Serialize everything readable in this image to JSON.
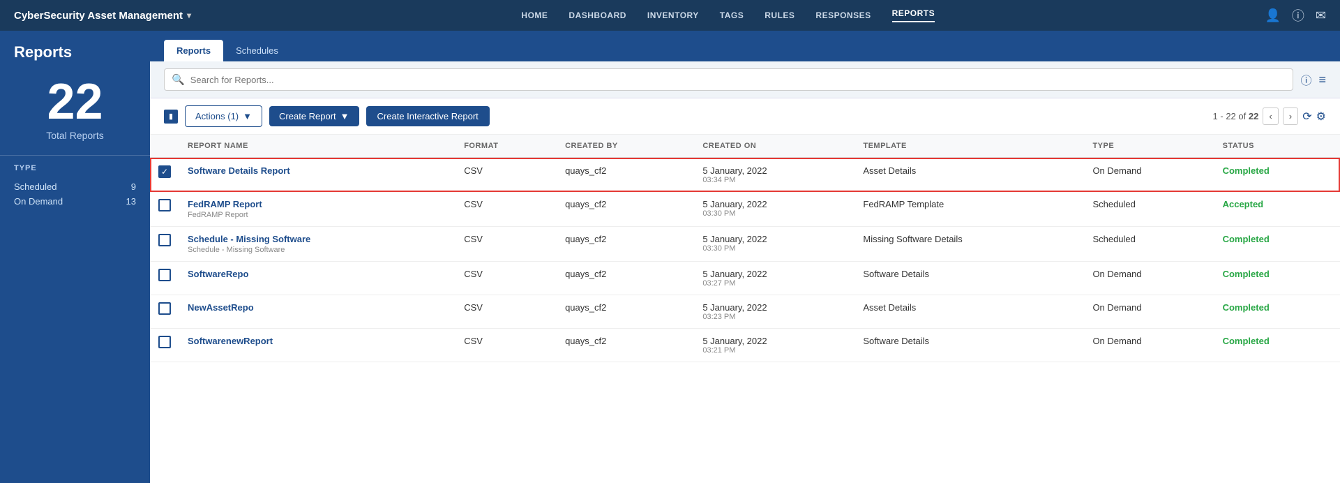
{
  "app": {
    "title": "CyberSecurity Asset Management",
    "dropdown_arrow": "▾"
  },
  "nav": {
    "items": [
      {
        "label": "HOME",
        "active": false
      },
      {
        "label": "DASHBOARD",
        "active": false
      },
      {
        "label": "INVENTORY",
        "active": false
      },
      {
        "label": "TAGS",
        "active": false
      },
      {
        "label": "RULES",
        "active": false
      },
      {
        "label": "RESPONSES",
        "active": false
      },
      {
        "label": "REPORTS",
        "active": true
      }
    ]
  },
  "sidebar": {
    "title": "Reports",
    "total_count": "22",
    "total_label": "Total Reports",
    "filter_title": "TYPE",
    "filters": [
      {
        "name": "Scheduled",
        "count": "9"
      },
      {
        "name": "On Demand",
        "count": "13"
      }
    ]
  },
  "tabs": [
    {
      "label": "Reports",
      "active": true
    },
    {
      "label": "Schedules",
      "active": false
    }
  ],
  "toolbar": {
    "search_placeholder": "Search for Reports...",
    "help_icon": "?",
    "menu_icon": "≡"
  },
  "actions_bar": {
    "actions_label": "Actions (1)",
    "create_report_label": "Create Report",
    "create_interactive_label": "Create Interactive Report",
    "pagination_text": "1 - 22 of",
    "pagination_total": "22"
  },
  "table": {
    "headers": [
      "",
      "REPORT NAME",
      "FORMAT",
      "CREATED BY",
      "CREATED ON",
      "TEMPLATE",
      "TYPE",
      "STATUS"
    ],
    "rows": [
      {
        "selected": true,
        "name": "Software Details Report",
        "sub": "",
        "format": "CSV",
        "created_by": "quays_cf2",
        "created_on": "5 January, 2022",
        "created_time": "03:34 PM",
        "template": "Asset Details",
        "type": "On Demand",
        "status": "Completed",
        "status_class": "status-completed"
      },
      {
        "selected": false,
        "name": "FedRAMP Report",
        "sub": "FedRAMP Report",
        "format": "CSV",
        "created_by": "quays_cf2",
        "created_on": "5 January, 2022",
        "created_time": "03:30 PM",
        "template": "FedRAMP Template",
        "type": "Scheduled",
        "status": "Accepted",
        "status_class": "status-accepted"
      },
      {
        "selected": false,
        "name": "Schedule - Missing Software",
        "sub": "Schedule - Missing Software",
        "format": "CSV",
        "created_by": "quays_cf2",
        "created_on": "5 January, 2022",
        "created_time": "03:30 PM",
        "template": "Missing Software Details",
        "type": "Scheduled",
        "status": "Completed",
        "status_class": "status-completed"
      },
      {
        "selected": false,
        "name": "SoftwareRepo",
        "sub": "",
        "format": "CSV",
        "created_by": "quays_cf2",
        "created_on": "5 January, 2022",
        "created_time": "03:27 PM",
        "template": "Software Details",
        "type": "On Demand",
        "status": "Completed",
        "status_class": "status-completed"
      },
      {
        "selected": false,
        "name": "NewAssetRepo",
        "sub": "",
        "format": "CSV",
        "created_by": "quays_cf2",
        "created_on": "5 January, 2022",
        "created_time": "03:23 PM",
        "template": "Asset Details",
        "type": "On Demand",
        "status": "Completed",
        "status_class": "status-completed"
      },
      {
        "selected": false,
        "name": "SoftwarenewReport",
        "sub": "",
        "format": "CSV",
        "created_by": "quays_cf2",
        "created_on": "5 January, 2022",
        "created_time": "03:21 PM",
        "template": "Software Details",
        "type": "On Demand",
        "status": "Completed",
        "status_class": "status-completed"
      }
    ]
  }
}
